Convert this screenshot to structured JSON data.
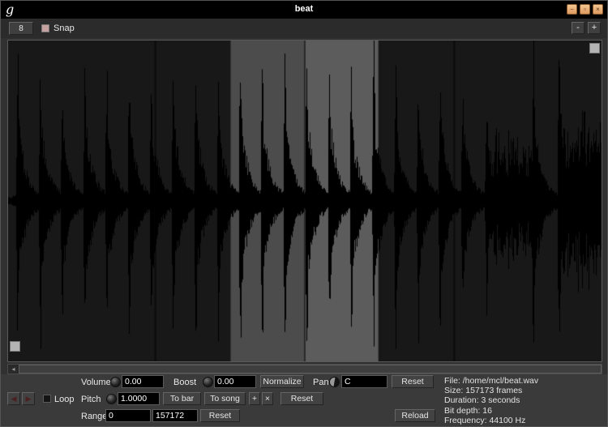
{
  "window": {
    "title": "beat",
    "icon": "g",
    "controls": {
      "minimize": "−",
      "maximize": "▫",
      "close": "×"
    }
  },
  "toolbar": {
    "grid_value": "8",
    "snap_label": "Snap",
    "zoom_out": "-",
    "zoom_in": "+"
  },
  "scrollbar": {
    "left_arrow": "◂"
  },
  "controls": {
    "transport": {
      "prev": "◀",
      "next": "▶"
    },
    "loop_label": "Loop",
    "volume": {
      "label": "Volume",
      "value": "0.00"
    },
    "boost": {
      "label": "Boost",
      "value": "0.00",
      "normalize": "Normalize"
    },
    "pan": {
      "label": "Pan",
      "value": "C",
      "reset": "Reset"
    },
    "pitch": {
      "label": "Pitch",
      "value": "1.0000",
      "to_bar": "To bar",
      "to_song": "To song",
      "plus": "+",
      "times": "×",
      "reset": "Reset"
    },
    "range": {
      "label": "Range",
      "start": "0",
      "end": "157172",
      "reset": "Reset"
    },
    "reload": "Reload"
  },
  "file_info": {
    "file": "File: /home/mcl/beat.wav",
    "size": "Size: 157173 frames",
    "duration": "Duration: 3 seconds",
    "bit_depth": "Bit depth: 16",
    "frequency": "Frequency: 44100 Hz"
  },
  "waveform": {
    "bg": "#181818",
    "color": "#000000",
    "noise_floor": 0.03,
    "regions": [
      {
        "start": 0.375,
        "end": 0.5,
        "color": "#4c4c4c"
      },
      {
        "start": 0.5,
        "end": 0.625,
        "color": "#5c5c5c"
      }
    ],
    "bar_lines": [
      0.248,
      0.5,
      0.625,
      0.752
    ],
    "spikes": [
      [
        0.016,
        0.78
      ],
      [
        0.054,
        0.8
      ],
      [
        0.091,
        0.72
      ],
      [
        0.129,
        0.8
      ],
      [
        0.166,
        0.75
      ],
      [
        0.204,
        0.78
      ],
      [
        0.241,
        0.74
      ],
      [
        0.278,
        0.82
      ],
      [
        0.316,
        0.78
      ],
      [
        0.354,
        0.74
      ],
      [
        0.391,
        0.85
      ],
      [
        0.428,
        0.8
      ],
      [
        0.466,
        0.78
      ],
      [
        0.503,
        0.83
      ],
      [
        0.541,
        0.8
      ],
      [
        0.578,
        0.76
      ],
      [
        0.616,
        0.82
      ],
      [
        0.653,
        0.78
      ],
      [
        0.691,
        0.74
      ],
      [
        0.728,
        0.78
      ],
      [
        0.766,
        0.72
      ],
      [
        0.806,
        0.6
      ],
      [
        0.885,
        0.84
      ],
      [
        0.928,
        0.8
      ]
    ],
    "noise_blocks": [
      {
        "start": 0.805,
        "end": 0.884,
        "amp": 0.33
      },
      {
        "start": 0.928,
        "end": 1.0,
        "amp": 0.44
      }
    ]
  }
}
